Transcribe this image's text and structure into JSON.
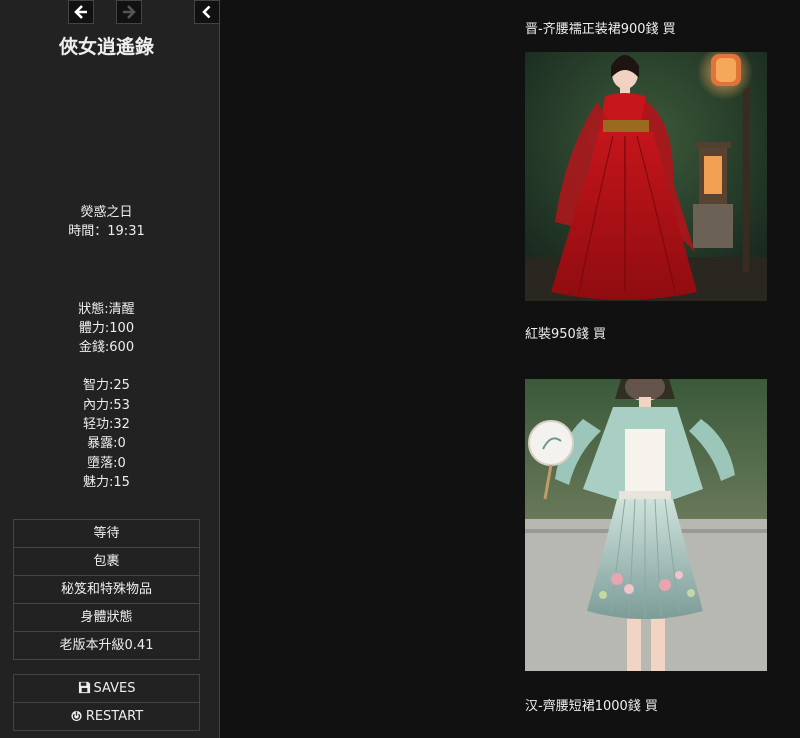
{
  "sidebar": {
    "title": "俠女逍遙錄",
    "day": "熒惑之日",
    "time": "時間：19:31",
    "status": "狀態:清醒",
    "stamina": "體力:100",
    "money": "金錢:600",
    "intelligence": "智力:25",
    "inner_power": "內力:53",
    "qinggong": "轻功:32",
    "exposure": "暴露:0",
    "corruption": "墮落:0",
    "charm": "魅力:15",
    "menu": [
      "等待",
      "包裹",
      "秘笈和特殊物品",
      "身體狀態",
      "老版本升級0.41"
    ],
    "saves_label": "SAVES",
    "restart_label": "RESTART"
  },
  "shop": {
    "items": [
      {
        "label": "晋-齐腰襦正装裙900錢 買",
        "image": "red-hanfu-dress-photo"
      },
      {
        "label": "紅裝950錢 買",
        "image": "mint-hanfu-short-skirt-photo"
      },
      {
        "label": "汉-齊腰短裙1000錢 買"
      }
    ]
  },
  "colors": {
    "sidebar_bg": "#222222",
    "main_bg": "#111111",
    "border": "#444444",
    "text": "#eeeeee"
  }
}
